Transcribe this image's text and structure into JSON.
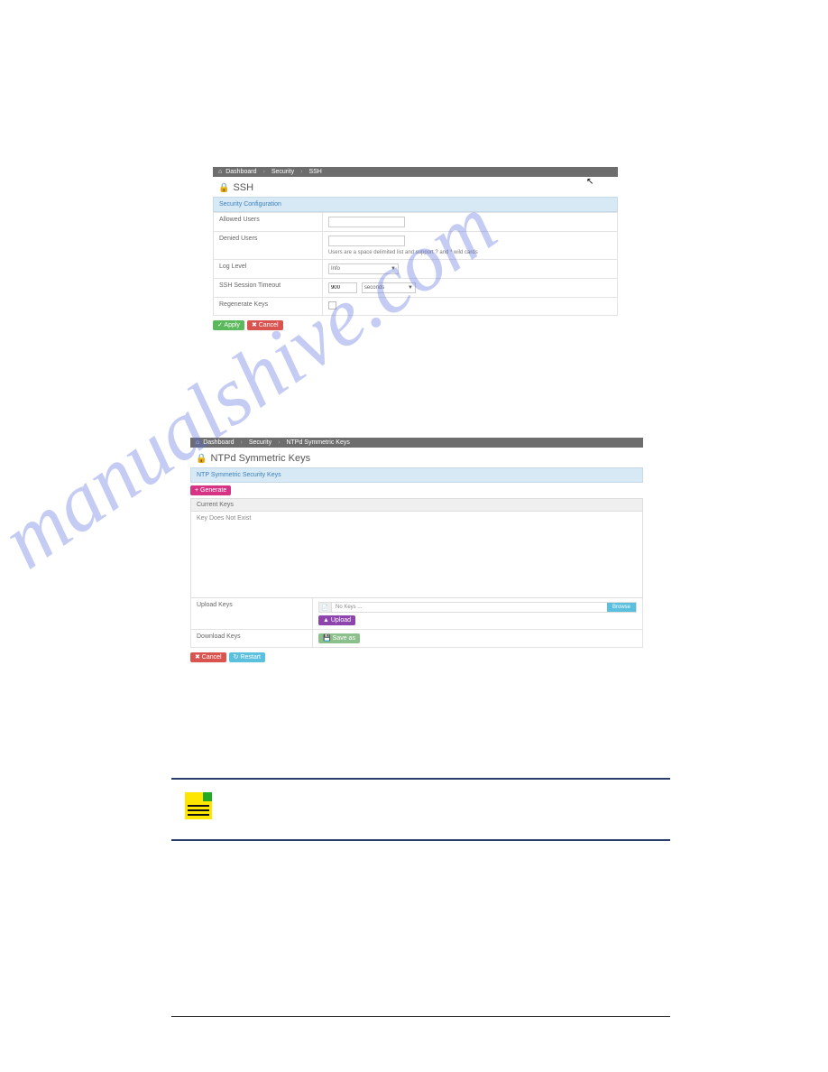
{
  "watermark": "manualshive.com",
  "screenshot1": {
    "breadcrumbs": {
      "home": "Dashboard",
      "sec": "Security",
      "page": "SSH"
    },
    "title": "SSH",
    "section_head": "Security Configuration",
    "rows": {
      "allowed_users": "Allowed Users",
      "denied_users": "Denied Users",
      "denied_help": "Users are a space delimited list and support ? and * wild cards",
      "log_level": "Log Level",
      "log_level_value": "Info",
      "timeout": "SSH Session Timeout",
      "timeout_value": "900",
      "timeout_unit": "seconds",
      "regen": "Regenerate Keys"
    },
    "buttons": {
      "apply": "✓ Apply",
      "cancel": "✖ Cancel"
    }
  },
  "screenshot2": {
    "breadcrumbs": {
      "home": "Dashboard",
      "sec": "Security",
      "page": "NTPd Symmetric Keys"
    },
    "title": "NTPd Symmetric Keys",
    "section_head": "NTP Symmetric Security Keys",
    "generate": "+ Generate",
    "current_keys_head": "Current Keys",
    "key_status": "Key Does Not Exist",
    "upload_label": "Upload Keys",
    "file_none": "No Keys ...",
    "browse": "Browse",
    "upload_btn": "▲ Upload",
    "download_label": "Download Keys",
    "saveas_btn": "💾 Save as",
    "cancel": "✖ Cancel",
    "restart": "↻ Restart"
  },
  "note_caption": ""
}
